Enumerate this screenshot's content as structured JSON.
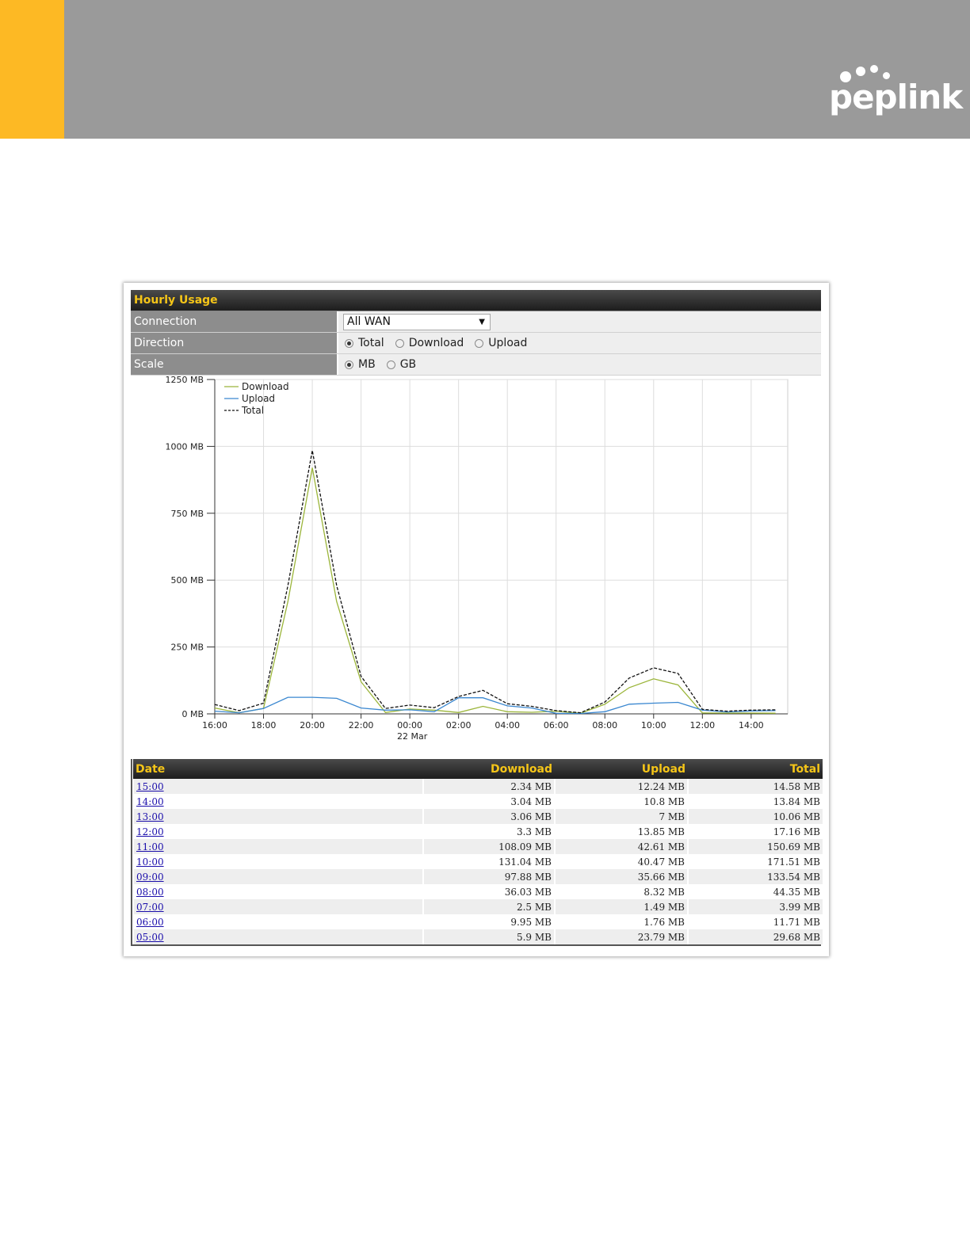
{
  "brand": {
    "logo_text": "peplink",
    "accent": "#fdb924",
    "banner": "#9a9a9a"
  },
  "panel": {
    "title": "Hourly Usage",
    "connection": {
      "label": "Connection",
      "value": "All WAN"
    },
    "direction": {
      "label": "Direction",
      "options": [
        "Total",
        "Download",
        "Upload"
      ],
      "selected": "Total"
    },
    "scale": {
      "label": "Scale",
      "options": [
        "MB",
        "GB"
      ],
      "selected": "MB"
    }
  },
  "chart_data": {
    "type": "line",
    "x": [
      "16:00",
      "17:00",
      "18:00",
      "19:00",
      "20:00",
      "21:00",
      "22:00",
      "23:00",
      "00:00",
      "01:00",
      "02:00",
      "03:00",
      "04:00",
      "05:00",
      "06:00",
      "07:00",
      "08:00",
      "09:00",
      "10:00",
      "11:00",
      "12:00",
      "13:00",
      "14:00",
      "15:00"
    ],
    "x_ticks": [
      "16:00",
      "18:00",
      "20:00",
      "22:00",
      "00:00",
      "02:00",
      "04:00",
      "06:00",
      "08:00",
      "10:00",
      "12:00",
      "14:00"
    ],
    "x_subtick": {
      "tick": "00:00",
      "label": "22 Mar"
    },
    "y_ticks": [
      "0 MB",
      "250 MB",
      "500 MB",
      "750 MB",
      "1000 MB",
      "1250 MB"
    ],
    "ylim": [
      0,
      1250
    ],
    "grid": true,
    "legend": "top-left",
    "series": [
      {
        "name": "Download",
        "color": "#9bb53a",
        "values": [
          22,
          4,
          20,
          420,
          920,
          420,
          120,
          5,
          18,
          14,
          5,
          28,
          8,
          6,
          10,
          2.5,
          36,
          98,
          131,
          108,
          3.3,
          3.06,
          3.04,
          2.34
        ]
      },
      {
        "name": "Upload",
        "color": "#3a87d0",
        "values": [
          10,
          4,
          20,
          62,
          62,
          58,
          22,
          14,
          15,
          8,
          60,
          60,
          30,
          22,
          2,
          1.5,
          8,
          36,
          40,
          43,
          14,
          7,
          11,
          12
        ]
      },
      {
        "name": "Total",
        "color": "#111111",
        "values": [
          35,
          12,
          40,
          480,
          985,
          480,
          140,
          20,
          33,
          23,
          65,
          88,
          38,
          28,
          12,
          4,
          44,
          134,
          172,
          151,
          17,
          10,
          14,
          15
        ]
      }
    ]
  },
  "table": {
    "headers": [
      "Date",
      "Download",
      "Upload",
      "Total"
    ],
    "rows": [
      [
        "15:00",
        "2.34 MB",
        "12.24 MB",
        "14.58 MB"
      ],
      [
        "14:00",
        "3.04 MB",
        "10.8 MB",
        "13.84 MB"
      ],
      [
        "13:00",
        "3.06 MB",
        "7 MB",
        "10.06 MB"
      ],
      [
        "12:00",
        "3.3 MB",
        "13.85 MB",
        "17.16 MB"
      ],
      [
        "11:00",
        "108.09 MB",
        "42.61 MB",
        "150.69 MB"
      ],
      [
        "10:00",
        "131.04 MB",
        "40.47 MB",
        "171.51 MB"
      ],
      [
        "09:00",
        "97.88 MB",
        "35.66 MB",
        "133.54 MB"
      ],
      [
        "08:00",
        "36.03 MB",
        "8.32 MB",
        "44.35 MB"
      ],
      [
        "07:00",
        "2.5 MB",
        "1.49 MB",
        "3.99 MB"
      ],
      [
        "06:00",
        "9.95 MB",
        "1.76 MB",
        "11.71 MB"
      ],
      [
        "05:00",
        "5.9 MB",
        "23.79 MB",
        "29.68 MB"
      ]
    ]
  }
}
